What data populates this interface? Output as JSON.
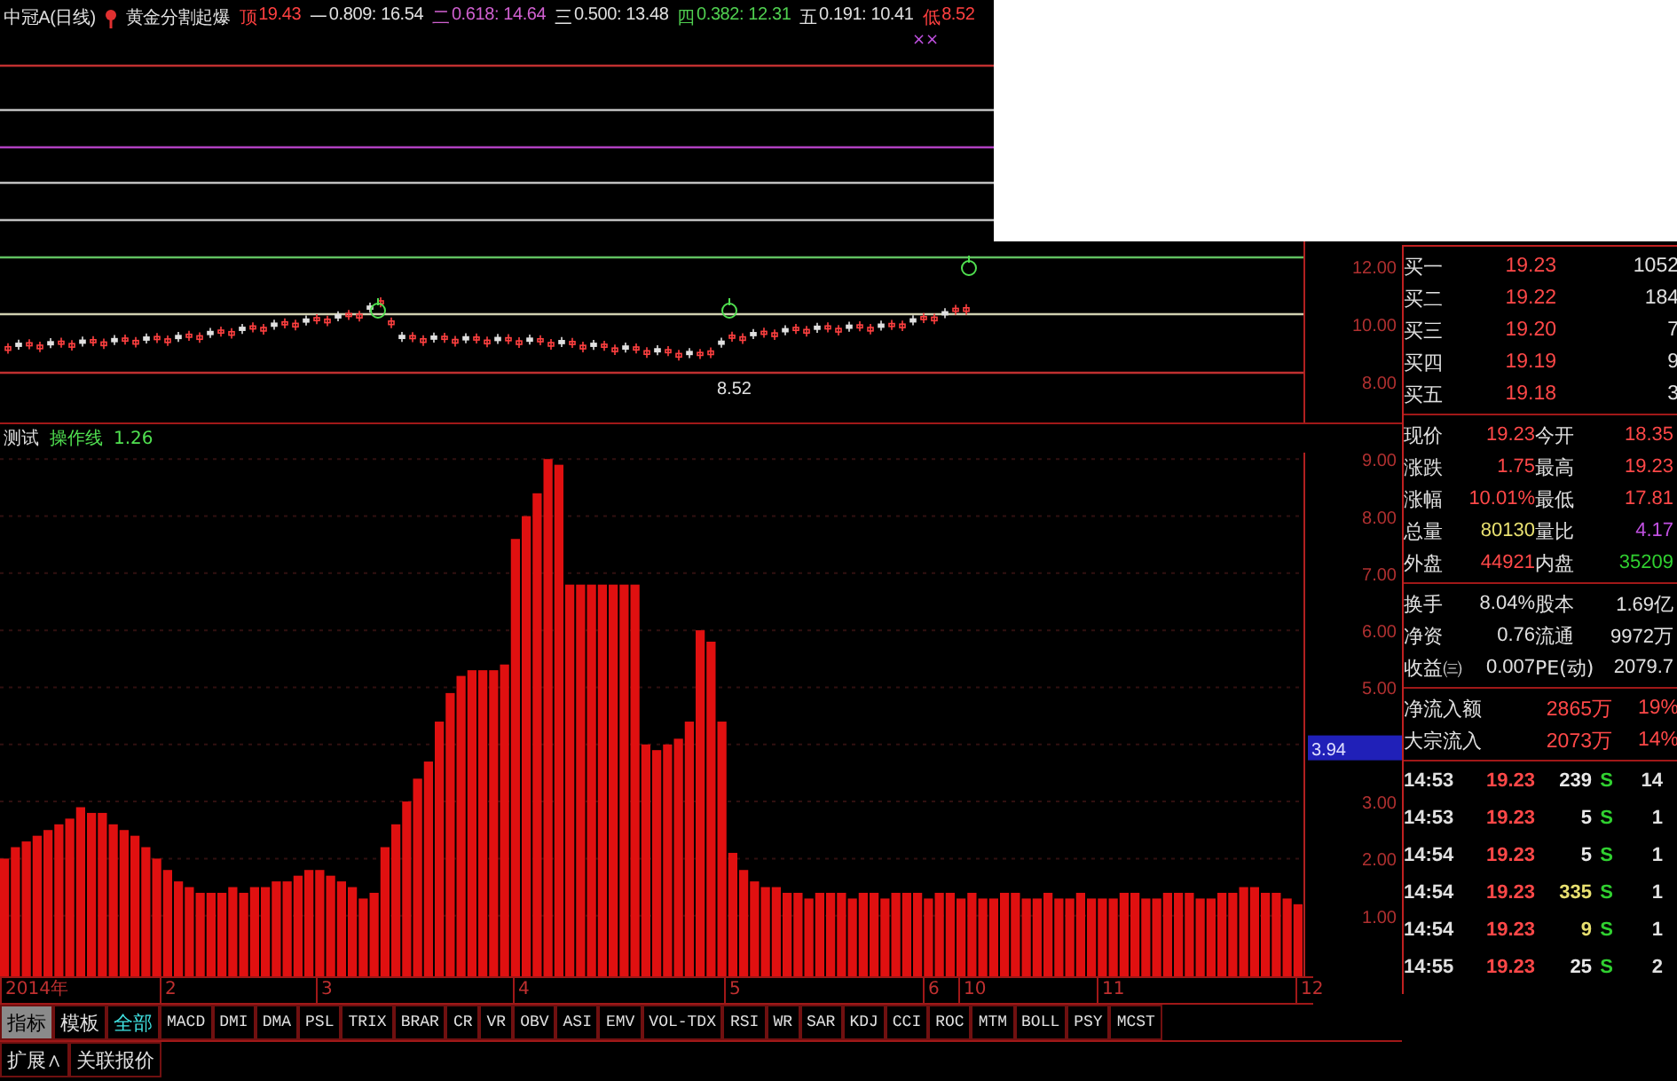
{
  "header": {
    "title": "中冠A(日线)",
    "indicator": "黄金分割起爆",
    "levels": [
      {
        "label": "顶",
        "value": "19.43",
        "color": "#ff4040"
      },
      {
        "label": "一",
        "value": "0.809: 16.54",
        "color": "#e0e0e0"
      },
      {
        "label": "二",
        "value": "0.618: 14.64",
        "color": "#d060d0"
      },
      {
        "label": "三",
        "value": "0.500: 13.48",
        "color": "#e0e0e0"
      },
      {
        "label": "四",
        "value": "0.382: 12.31",
        "color": "#50d050"
      },
      {
        "label": "五",
        "value": "0.191: 10.41",
        "color": "#e0e0e0"
      },
      {
        "label": "低",
        "value": "8.52",
        "color": "#ff4040"
      }
    ],
    "marks": "××"
  },
  "price_chart": {
    "axis_labels": [
      "12.00",
      "10.00",
      "8.00"
    ],
    "low_label": "8.52"
  },
  "indicator_panel": {
    "name": "测试",
    "line_label": "操作线",
    "line_value": "1.26",
    "cursor_value": "3.94",
    "x_axis_labels": [
      "2014年",
      "2",
      "3",
      "4",
      "5",
      "6",
      "10",
      "11",
      "12"
    ],
    "chart_data": {
      "type": "bar",
      "ylim": [
        0,
        9.05
      ],
      "grid": true,
      "values": [
        2.0,
        2.2,
        2.3,
        2.4,
        2.5,
        2.6,
        2.7,
        2.9,
        2.8,
        2.8,
        2.6,
        2.5,
        2.4,
        2.2,
        2.0,
        1.8,
        1.6,
        1.5,
        1.4,
        1.4,
        1.4,
        1.5,
        1.4,
        1.5,
        1.5,
        1.6,
        1.6,
        1.7,
        1.8,
        1.8,
        1.7,
        1.6,
        1.5,
        1.3,
        1.4,
        2.2,
        2.6,
        3.0,
        3.4,
        3.7,
        4.4,
        4.9,
        5.2,
        5.3,
        5.3,
        5.3,
        5.4,
        7.6,
        8.0,
        8.4,
        9.0,
        8.9,
        6.8,
        6.8,
        6.8,
        6.8,
        6.8,
        6.8,
        6.8,
        4.0,
        3.9,
        4.0,
        4.1,
        4.4,
        6.0,
        5.8,
        4.4,
        2.1,
        1.8,
        1.6,
        1.5,
        1.5,
        1.4,
        1.4,
        1.3,
        1.4,
        1.4,
        1.4,
        1.3,
        1.4,
        1.4,
        1.3,
        1.4,
        1.4,
        1.4,
        1.3,
        1.4,
        1.4,
        1.3,
        1.4,
        1.3,
        1.3,
        1.4,
        1.4,
        1.3,
        1.3,
        1.4,
        1.3,
        1.3,
        1.4,
        1.3,
        1.3,
        1.3,
        1.4,
        1.4,
        1.3,
        1.3,
        1.4,
        1.4,
        1.4,
        1.3,
        1.3,
        1.4,
        1.4,
        1.5,
        1.5,
        1.4,
        1.4,
        1.3,
        1.2
      ],
      "yticks": [
        {
          "value": 1,
          "label": "1.00"
        },
        {
          "value": 2,
          "label": "2.00"
        },
        {
          "value": 3,
          "label": "3.00"
        },
        {
          "value": 5,
          "label": "5.00"
        },
        {
          "value": 6,
          "label": "6.00"
        },
        {
          "value": 7,
          "label": "7.00"
        },
        {
          "value": 8,
          "label": "8.00"
        },
        {
          "value": 9,
          "label": "9.00"
        }
      ]
    }
  },
  "tabs": [
    {
      "label": "指标",
      "kind": "panel",
      "selected": true
    },
    {
      "label": "模板",
      "kind": "panel",
      "selected": false
    },
    {
      "label": "全部",
      "kind": "all",
      "selected": false
    },
    {
      "label": "MACD",
      "kind": "indicator",
      "selected": false
    },
    {
      "label": "DMI",
      "kind": "indicator",
      "selected": false
    },
    {
      "label": "DMA",
      "kind": "indicator",
      "selected": false
    },
    {
      "label": "PSL",
      "kind": "indicator",
      "selected": false
    },
    {
      "label": "TRIX",
      "kind": "indicator",
      "selected": false
    },
    {
      "label": "BRAR",
      "kind": "indicator",
      "selected": false
    },
    {
      "label": "CR",
      "kind": "indicator",
      "selected": false
    },
    {
      "label": "VR",
      "kind": "indicator",
      "selected": false
    },
    {
      "label": "OBV",
      "kind": "indicator",
      "selected": false
    },
    {
      "label": "ASI",
      "kind": "indicator",
      "selected": false
    },
    {
      "label": "EMV",
      "kind": "indicator",
      "selected": false
    },
    {
      "label": "VOL-TDX",
      "kind": "indicator",
      "selected": false
    },
    {
      "label": "RSI",
      "kind": "indicator",
      "selected": false
    },
    {
      "label": "WR",
      "kind": "indicator",
      "selected": false
    },
    {
      "label": "SAR",
      "kind": "indicator",
      "selected": false
    },
    {
      "label": "KDJ",
      "kind": "indicator",
      "selected": false
    },
    {
      "label": "CCI",
      "kind": "indicator",
      "selected": false
    },
    {
      "label": "ROC",
      "kind": "indicator",
      "selected": false
    },
    {
      "label": "MTM",
      "kind": "indicator",
      "selected": false
    },
    {
      "label": "BOLL",
      "kind": "indicator",
      "selected": false
    },
    {
      "label": "PSY",
      "kind": "indicator",
      "selected": false
    },
    {
      "label": "MCST",
      "kind": "indicator",
      "selected": false
    }
  ],
  "bottom_tabs": [
    "扩展∧",
    "关联报价"
  ],
  "quote": {
    "bids": [
      {
        "label": "买一",
        "price": "19.23",
        "volume": "1052"
      },
      {
        "label": "买二",
        "price": "19.22",
        "volume": "184"
      },
      {
        "label": "买三",
        "price": "19.20",
        "volume": "7"
      },
      {
        "label": "买四",
        "price": "19.19",
        "volume": "9"
      },
      {
        "label": "买五",
        "price": "19.18",
        "volume": "3"
      }
    ],
    "stats": [
      {
        "label": "现价",
        "value": "19.23",
        "color": "#ff4848"
      },
      {
        "label": "今开",
        "value": "18.35",
        "color": "#ff4848"
      },
      {
        "label": "涨跌",
        "value": "1.75",
        "color": "#ff4848"
      },
      {
        "label": "最高",
        "value": "19.23",
        "color": "#ff4848"
      },
      {
        "label": "涨幅",
        "value": "10.01%",
        "color": "#ff4848"
      },
      {
        "label": "最低",
        "value": "17.81",
        "color": "#ff4848"
      },
      {
        "label": "总量",
        "value": "80130",
        "color": "#e8e070"
      },
      {
        "label": "量比",
        "value": "4.17",
        "color": "#c050e0"
      },
      {
        "label": "外盘",
        "value": "44921",
        "color": "#ff4848"
      },
      {
        "label": "内盘",
        "value": "35209",
        "color": "#30d030"
      }
    ],
    "fundamentals": [
      {
        "label": "换手",
        "value": "8.04%",
        "label2": "股本",
        "value2": "1.69亿"
      },
      {
        "label": "净资",
        "value": "0.76",
        "label2": "流通",
        "value2": "9972万"
      },
      {
        "label": "收益㈢",
        "value": "0.007",
        "label2": "PE(动)",
        "value2": "2079.7"
      }
    ],
    "flows": [
      {
        "label": "净流入额",
        "value": "2865万",
        "share": "19%"
      },
      {
        "label": "大宗流入",
        "value": "2073万",
        "share": "14%"
      }
    ],
    "ticks": [
      {
        "time": "14:53",
        "price": "19.23",
        "volume": "239",
        "color": "#e8e8e8",
        "side": "S",
        "extra": "14"
      },
      {
        "time": "14:53",
        "price": "19.23",
        "volume": "5",
        "color": "#e8e8e8",
        "side": "S",
        "extra": "1"
      },
      {
        "time": "14:54",
        "price": "19.23",
        "volume": "5",
        "color": "#e8e8e8",
        "side": "S",
        "extra": "1"
      },
      {
        "time": "14:54",
        "price": "19.23",
        "volume": "335",
        "color": "#e8e070",
        "side": "S",
        "extra": "1"
      },
      {
        "time": "14:54",
        "price": "19.23",
        "volume": "9",
        "color": "#e8e070",
        "side": "S",
        "extra": "1"
      },
      {
        "time": "14:55",
        "price": "19.23",
        "volume": "25",
        "color": "#e8e8e8",
        "side": "S",
        "extra": "2"
      }
    ]
  }
}
